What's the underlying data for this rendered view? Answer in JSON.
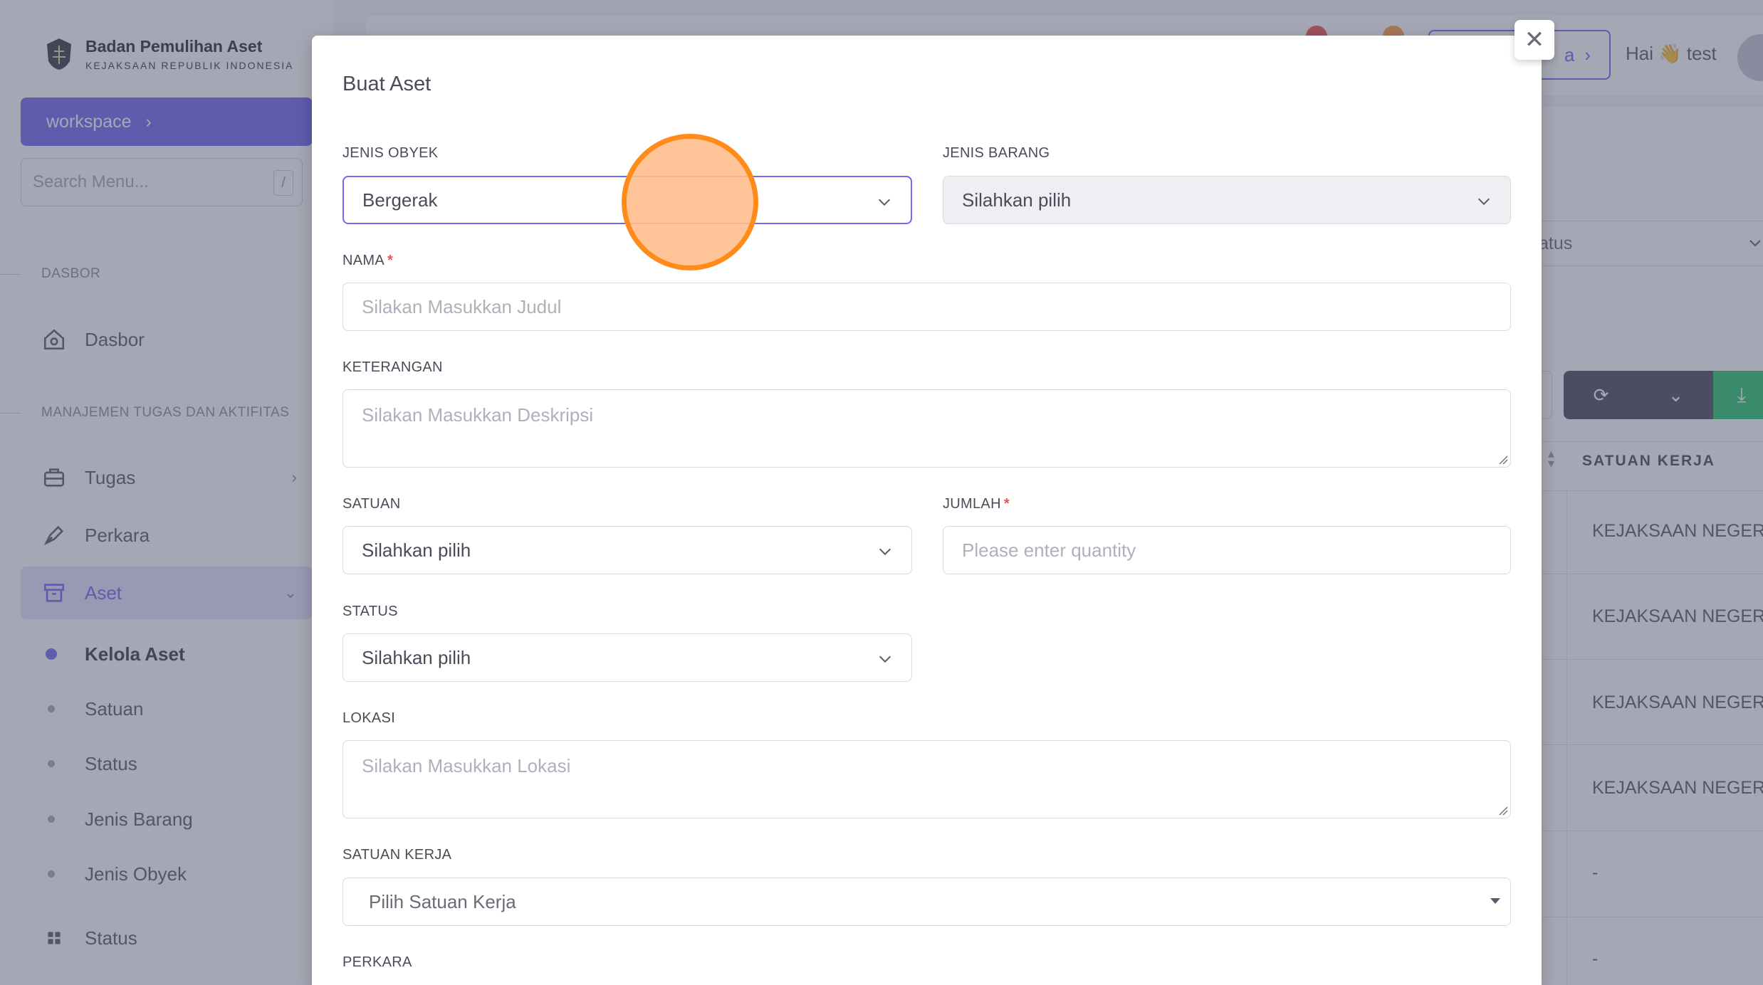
{
  "sidebar": {
    "brand_title": "Badan Pemulihan Aset",
    "brand_subtitle": "KEJAKSAAN REPUBLIK INDONESIA",
    "workspace_label": "workspace",
    "search_placeholder": "Search Menu...",
    "search_shortcut": "/",
    "sections": {
      "dasbor": "DASBOR",
      "manajemen": "MANAJEMEN TUGAS DAN AKTIFITAS"
    },
    "items": {
      "dasbor": "Dasbor",
      "tugas": "Tugas",
      "perkara": "Perkara",
      "aset": "Aset",
      "status_main": "Status"
    },
    "sub_items": [
      "Kelola Aset",
      "Satuan",
      "Status",
      "Jenis Barang",
      "Jenis Obyek"
    ]
  },
  "topbar": {
    "pill_label": "a",
    "greeting": "Hai 👋 test"
  },
  "background_table": {
    "status_filter": "atus",
    "header": "SATUAN KERJA",
    "rows": [
      "KEJAKSAAN NEGERI S",
      "KEJAKSAAN NEGERI S",
      "KEJAKSAAN NEGERI S",
      "KEJAKSAAN NEGERI S",
      "-",
      "-"
    ]
  },
  "modal": {
    "title": "Buat Aset",
    "close_symbol": "✕",
    "fields": {
      "jenis_obyek": {
        "label": "JENIS OBYEK",
        "value": "Bergerak"
      },
      "jenis_barang": {
        "label": "JENIS BARANG",
        "value": "Silahkan pilih"
      },
      "nama": {
        "label": "NAMA",
        "required": "*",
        "placeholder": "Silakan Masukkan Judul"
      },
      "keterangan": {
        "label": "KETERANGAN",
        "placeholder": "Silakan Masukkan Deskripsi"
      },
      "satuan": {
        "label": "SATUAN",
        "value": "Silahkan pilih"
      },
      "jumlah": {
        "label": "JUMLAH",
        "required": "*",
        "placeholder": "Please enter quantity"
      },
      "status": {
        "label": "STATUS",
        "value": "Silahkan pilih"
      },
      "lokasi": {
        "label": "LOKASI",
        "placeholder": "Silakan Masukkan Lokasi"
      },
      "satuan_kerja": {
        "label": "SATUAN KERJA",
        "value": "Pilih Satuan Kerja"
      },
      "perkara": {
        "label": "PERKARA"
      }
    }
  },
  "colors": {
    "accent": "#7367f0",
    "click_marker": "#ff8c1a",
    "overlay": "#4b5069"
  }
}
